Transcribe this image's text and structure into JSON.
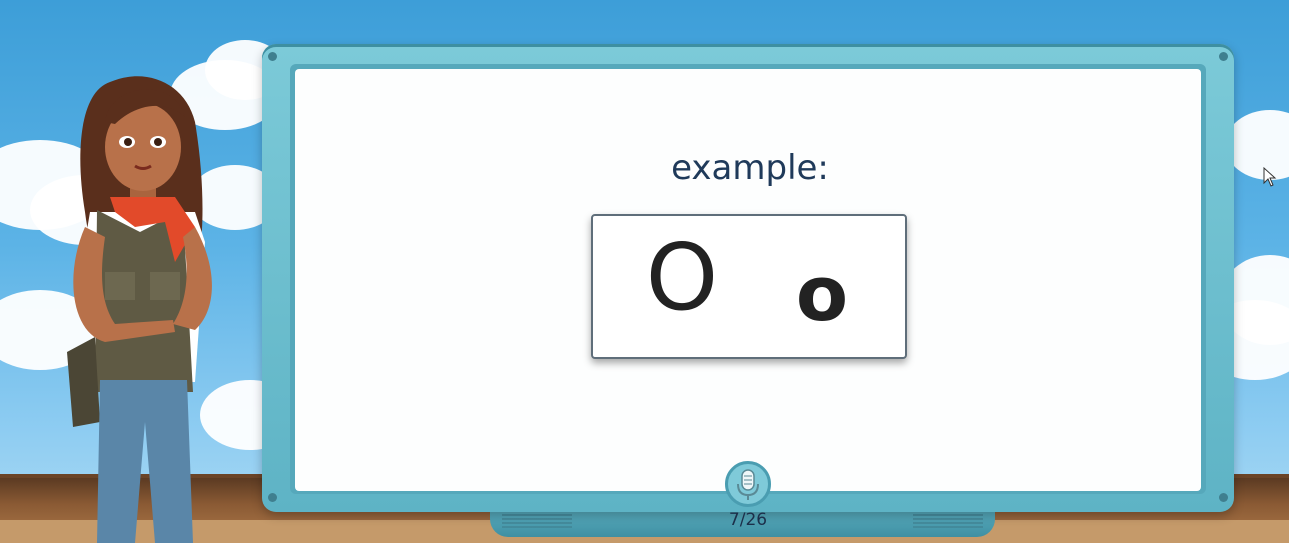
{
  "lesson": {
    "example_label": "example:",
    "letter_upper": "O",
    "letter_lower": "o"
  },
  "footer": {
    "slide_counter": "7/26"
  },
  "icons": {
    "mic": "microphone-icon",
    "cursor": "mouse-pointer-icon"
  },
  "colors": {
    "sky": "#5cb3e6",
    "board_frame": "#5eb3c5",
    "text": "#1f3a5a"
  }
}
